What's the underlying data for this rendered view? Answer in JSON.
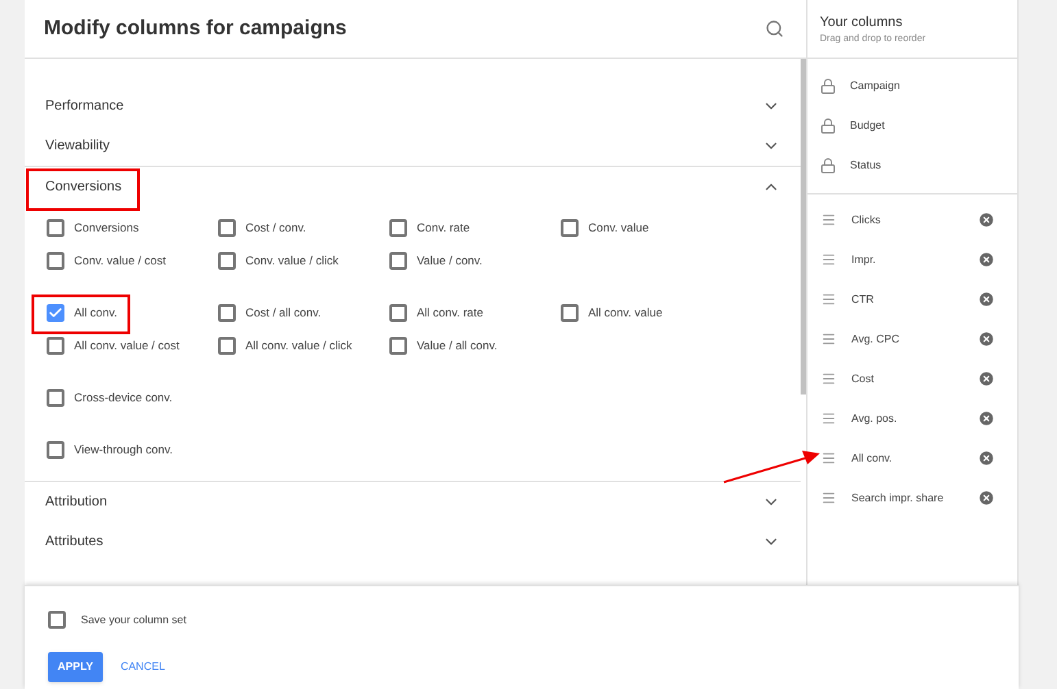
{
  "dialog": {
    "title": "Modify columns for campaigns"
  },
  "sections": [
    {
      "title": "Performance",
      "expanded": false
    },
    {
      "title": "Viewability",
      "expanded": false
    },
    {
      "title": "Conversions",
      "expanded": true,
      "groups": [
        {
          "items": [
            {
              "label": "Conversions",
              "checked": false
            },
            {
              "label": "Cost / conv.",
              "checked": false
            },
            {
              "label": "Conv. rate",
              "checked": false
            },
            {
              "label": "Conv. value",
              "checked": false
            },
            {
              "label": "Conv. value / cost",
              "checked": false
            },
            {
              "label": "Conv. value / click",
              "checked": false
            },
            {
              "label": "Value / conv.",
              "checked": false
            }
          ]
        },
        {
          "items": [
            {
              "label": "All conv.",
              "checked": true
            },
            {
              "label": "Cost / all conv.",
              "checked": false
            },
            {
              "label": "All conv. rate",
              "checked": false
            },
            {
              "label": "All conv. value",
              "checked": false
            },
            {
              "label": "All conv. value / cost",
              "checked": false
            },
            {
              "label": "All conv. value / click",
              "checked": false
            },
            {
              "label": "Value / all conv.",
              "checked": false
            }
          ]
        },
        {
          "items": [
            {
              "label": "Cross-device conv.",
              "checked": false
            }
          ]
        },
        {
          "items": [
            {
              "label": "View-through conv.",
              "checked": false
            }
          ]
        }
      ]
    },
    {
      "title": "Attribution",
      "expanded": false
    },
    {
      "title": "Attributes",
      "expanded": false
    }
  ],
  "your_columns": {
    "title": "Your columns",
    "subtitle": "Drag and drop to reorder",
    "locked": [
      "Campaign",
      "Budget",
      "Status"
    ],
    "columns": [
      "Clicks",
      "Impr.",
      "CTR",
      "Avg. CPC",
      "Cost",
      "Avg. pos.",
      "All conv.",
      "Search impr. share"
    ]
  },
  "footer": {
    "save_set": {
      "label": "Save your column set",
      "checked": false
    },
    "buttons": [
      "APPLY",
      "CANCEL"
    ]
  }
}
